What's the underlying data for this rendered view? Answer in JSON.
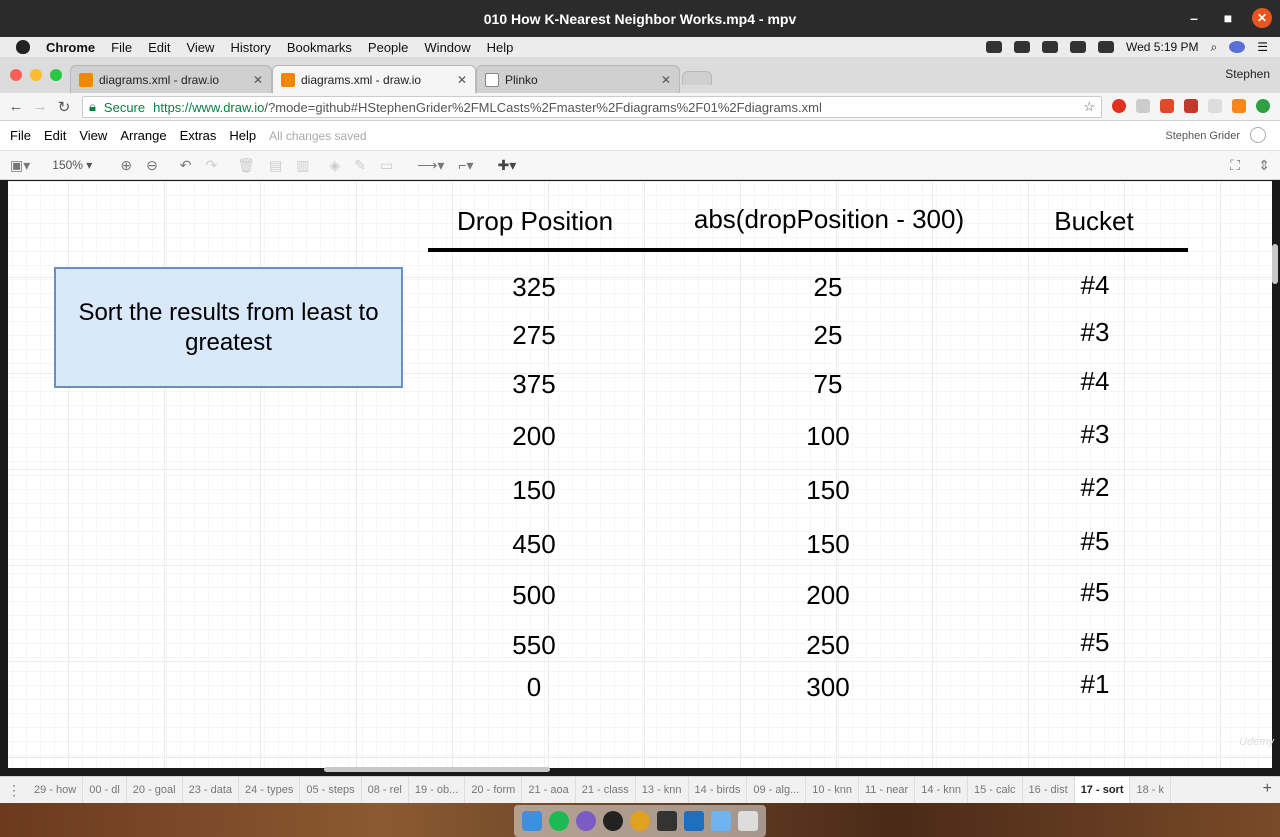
{
  "window": {
    "title": "010 How K-Nearest Neighbor Works.mp4 - mpv",
    "min": "–",
    "max": "■",
    "close": "✕"
  },
  "mac_menu": {
    "app": "Chrome",
    "items": [
      "File",
      "Edit",
      "View",
      "History",
      "Bookmarks",
      "People",
      "Window",
      "Help"
    ],
    "clock": "Wed 5:19 PM"
  },
  "tabs": [
    {
      "title": "diagrams.xml - draw.io",
      "icon": "drawio-icon"
    },
    {
      "title": "diagrams.xml - draw.io",
      "icon": "drawio-icon"
    },
    {
      "title": "Plinko",
      "icon": "document-icon"
    }
  ],
  "tab_close": "✕",
  "profile_name": "Stephen",
  "address": {
    "secure_label": "Secure",
    "url_scheme_host": "https://www.draw.io",
    "url_rest": "/?mode=github#HStephenGrider%2FMLCasts%2Fmaster%2Fdiagrams%2F01%2Fdiagrams.xml"
  },
  "drawio_menu": {
    "items": [
      "File",
      "Edit",
      "View",
      "Arrange",
      "Extras",
      "Help"
    ],
    "saved_status": "All changes saved",
    "user": "Stephen Grider"
  },
  "toolbar": {
    "zoom": "150%"
  },
  "note_text": "Sort the results from least to greatest",
  "table": {
    "headers": [
      "Drop Position",
      "abs(dropPosition - 300)",
      "Bucket"
    ],
    "rows": [
      [
        "325",
        "25",
        "#4"
      ],
      [
        "275",
        "25",
        "#3"
      ],
      [
        "375",
        "75",
        "#4"
      ],
      [
        "200",
        "100",
        "#3"
      ],
      [
        "150",
        "150",
        "#2"
      ],
      [
        "450",
        "150",
        "#5"
      ],
      [
        "500",
        "200",
        "#5"
      ],
      [
        "550",
        "250",
        "#5"
      ],
      [
        "0",
        "300",
        "#1"
      ]
    ]
  },
  "page_tabs": [
    "29 - how",
    "00 - dl",
    "20 - goal",
    "23 - data",
    "24 - types",
    "05 - steps",
    "08 - rel",
    "19 - ob...",
    "20 - form",
    "21 - aoa",
    "21 - class",
    "13 - knn",
    "14 - birds",
    "09 - alg...",
    "10 - knn",
    "11 - near",
    "14 - knn",
    "15 - calc",
    "16 - dist",
    "17 - sort",
    "18 - k"
  ],
  "active_page_tab": "17 - sort",
  "watermark": "Udemy",
  "colors": {
    "note_fill": "#dae8fc",
    "note_border": "#6c8ebf",
    "accent": "#f08705"
  }
}
